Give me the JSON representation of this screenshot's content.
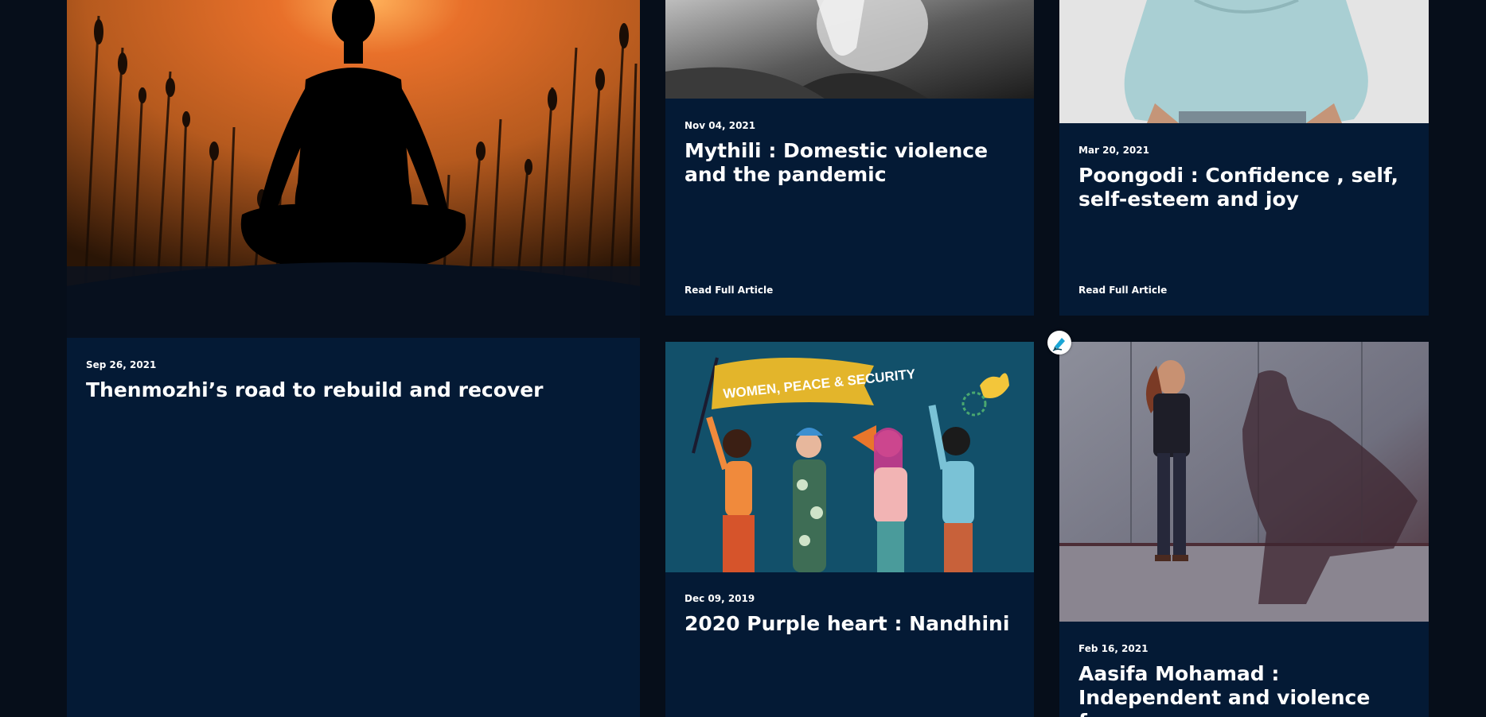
{
  "articles": [
    {
      "date": "Sep 26, 2021",
      "title": "Thenmozhi’s road to rebuild and recover",
      "image": "meditation-silhouette-sunset"
    },
    {
      "date": "Nov 04, 2021",
      "title": "Mythili : Domestic violence and the pandemic",
      "read_more": "Read Full Article",
      "image": "hand-grayscale"
    },
    {
      "date": "Mar 20, 2021",
      "title": "Poongodi : Confidence , self, self-esteem and joy",
      "read_more": "Read Full Article",
      "image": "woman-blue-sweater"
    },
    {
      "date": "Dec 09, 2019",
      "title": "2020 Purple heart : Nandhini",
      "image": "women-peace-security-illustration",
      "banner_text": "WOMEN, PEACE & SECURITY"
    },
    {
      "date": "Feb 16, 2021",
      "title": "Aasifa Mohamad : Independent and violence free",
      "image": "woman-superhero-shadow"
    }
  ],
  "edit_badge": {
    "icon": "pencil-edit-icon"
  },
  "colors": {
    "page_bg": "#060e1a",
    "card_bg": "#041a35",
    "text": "#ffffff",
    "edit_accent": "#1aa6d6"
  }
}
